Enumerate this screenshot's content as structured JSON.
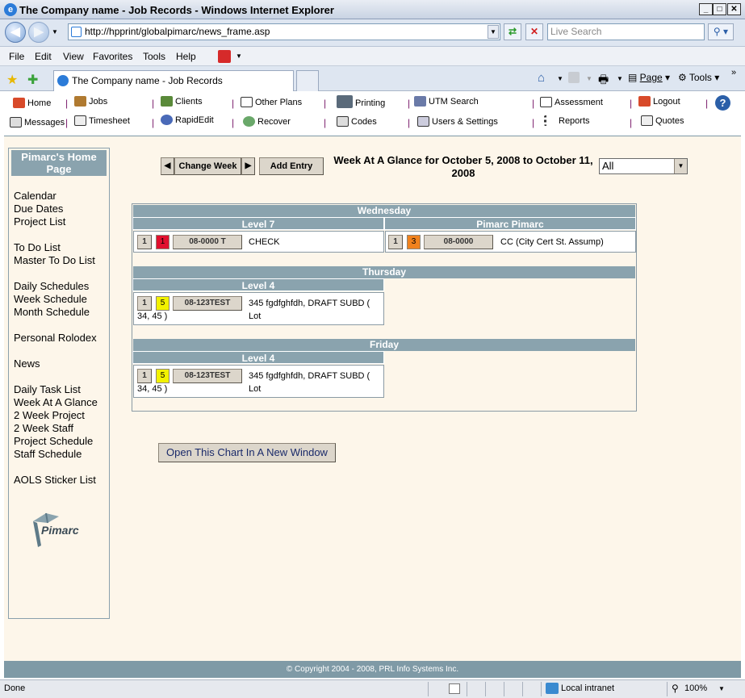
{
  "window": {
    "title": "The Company name - Job Records - Windows Internet Explorer",
    "minimize": "_",
    "maximize": "□",
    "close": "✕"
  },
  "browser": {
    "address": "http://hpprint/globalpimarc/news_frame.asp",
    "search_placeholder": "Live Search",
    "menu": [
      "File",
      "Edit",
      "View",
      "Favorites",
      "Tools",
      "Help"
    ],
    "tab_title": "The Company name - Job Records",
    "cmd": {
      "page": "Page",
      "tools": "Tools"
    }
  },
  "app_toolbar": {
    "row1": [
      "Home",
      "Jobs",
      "Clients",
      "Other Plans",
      "Printing",
      "UTM Search",
      "Assessment",
      "Logout"
    ],
    "row2": [
      "Messages",
      "Timesheet",
      "RapidEdit",
      "Recover",
      "Codes",
      "Users & Settings",
      "Reports",
      "Quotes"
    ]
  },
  "sidebar": {
    "title": "Pimarc's Home Page",
    "links": [
      "Calendar",
      "Due Dates",
      "Project List",
      "To Do List",
      "Master To Do List",
      "Daily Schedules",
      "Week Schedule",
      "Month Schedule",
      "Personal Rolodex",
      "News",
      "Daily Task List",
      "Week At A Glance",
      "2 Week Project",
      "2 Week Staff",
      "Project Schedule",
      "Staff Schedule",
      "AOLS Sticker List"
    ],
    "logo_text": "Pimarc"
  },
  "controls": {
    "prev": "◀",
    "change_week": "Change Week",
    "next": "▶",
    "add_entry": "Add Entry",
    "week_title": "Week At A Glance for October 5, 2008 to October 11, 2008",
    "filter_value": "All"
  },
  "schedule": {
    "days": [
      {
        "day": "Wednesday",
        "columns": [
          {
            "header": "Level 7",
            "entry": {
              "count": "1",
              "priority": "1",
              "priority_color": "#e0102e",
              "job": "08-0000 T",
              "desc": "CHECK"
            }
          },
          {
            "header": "Pimarc Pimarc",
            "entry": {
              "count": "1",
              "priority": "3",
              "priority_color": "#f0821e",
              "job": "08-0000",
              "desc": "CC (City Cert St. Assump)"
            }
          }
        ]
      },
      {
        "day": "Thursday",
        "columns": [
          {
            "header": "Level 4",
            "entry": {
              "count": "1",
              "priority": "5",
              "priority_color": "#f2f200",
              "job": "08-123TEST",
              "desc": "345 fgdfghfdh, DRAFT SUBD ( Lot",
              "desc2": "34, 45 )"
            }
          }
        ]
      },
      {
        "day": "Friday",
        "columns": [
          {
            "header": "Level 4",
            "entry": {
              "count": "1",
              "priority": "5",
              "priority_color": "#f2f200",
              "job": "08-123TEST",
              "desc": "345 fgdfghfdh, DRAFT SUBD ( Lot",
              "desc2": "34, 45 )"
            }
          }
        ]
      }
    ]
  },
  "open_chart": "Open This Chart In A New Window",
  "footer": "© Copyright 2004 - 2008, PRL Info Systems Inc.",
  "status": {
    "text": "Done",
    "zone": "Local intranet",
    "zoom": "100%"
  },
  "colors": {
    "header_bg": "#8aa3ae",
    "content_bg": "#fdf6ea"
  }
}
